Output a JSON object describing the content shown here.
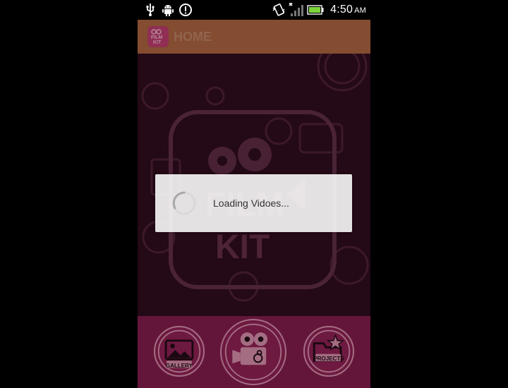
{
  "status_bar": {
    "time": "4:50",
    "ampm": "AM",
    "icons": [
      "usb-icon",
      "android-debug-icon",
      "alert-icon",
      "vibrate-icon",
      "signal-icon",
      "battery-icon"
    ],
    "battery_color": "#7cd43b"
  },
  "action_bar": {
    "title": "HOME",
    "app_icon_text": "FILM KIT",
    "background_color": "#a15d3b"
  },
  "loading_dialog": {
    "message": "Loading Vidoes..."
  },
  "bottom_nav": {
    "items": [
      {
        "label": "GALLERY",
        "icon": "gallery-icon"
      },
      {
        "label": "",
        "icon": "movie-camera-icon"
      },
      {
        "label": "PROJECTS",
        "icon": "projects-icon"
      }
    ]
  },
  "colors": {
    "content_bg": "#2c0c1b",
    "bottom_bar": "#7a1b47",
    "accent_pink": "#c9869f"
  }
}
